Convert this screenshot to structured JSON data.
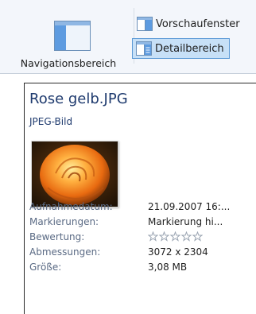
{
  "ribbon": {
    "navigation_label": "Navigationsbereich",
    "preview_label": "Vorschaufenster",
    "details_label": "Detailbereich"
  },
  "details": {
    "file_name": "Rose gelb.JPG",
    "file_type": "JPEG-Bild",
    "properties": [
      {
        "label": "Aufnahmedatum:",
        "value": "21.09.2007 16:..."
      },
      {
        "label": "Markierungen:",
        "value": "Markierung hi..."
      },
      {
        "label": "Bewertung:",
        "value": null,
        "stars": 0,
        "max_stars": 5
      },
      {
        "label": "Abmessungen:",
        "value": "3072 x 2304"
      },
      {
        "label": "Größe:",
        "value": "3,08 MB"
      }
    ]
  },
  "colors": {
    "ribbon_bg": "#f3f6fb",
    "selected_bg": "#c7e0f7",
    "selected_border": "#5c9ad6",
    "title_text": "#1e3a6e",
    "label_text": "#5a6a84"
  }
}
